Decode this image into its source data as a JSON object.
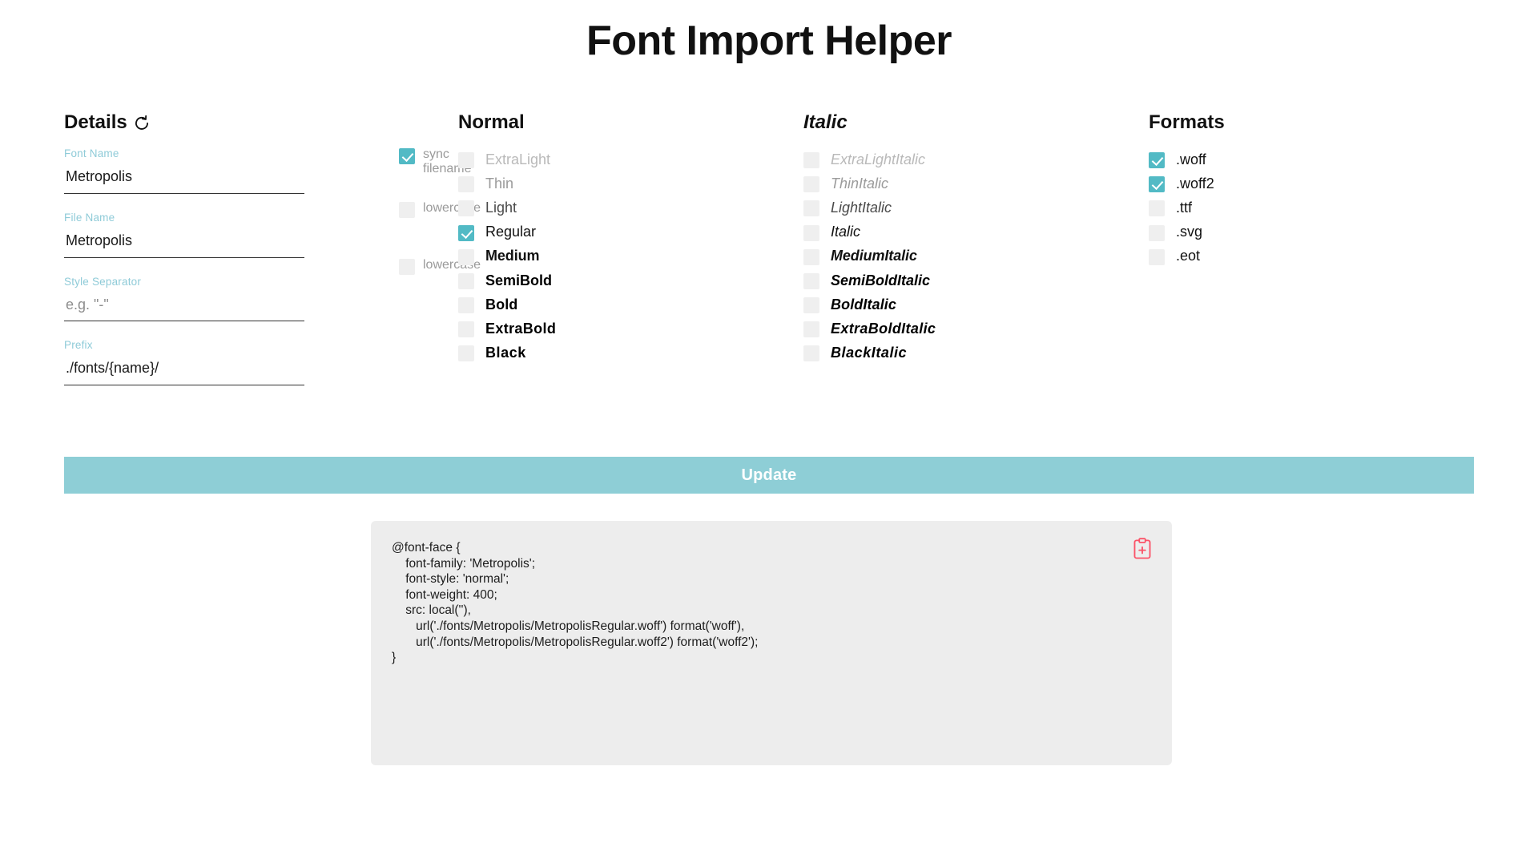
{
  "app": {
    "title": "Font Import Helper"
  },
  "details": {
    "heading": "Details",
    "reset_icon": "refresh-ccw-icon",
    "fields": [
      {
        "label": "Font Name",
        "value": "Metropolis",
        "placeholder": ""
      },
      {
        "label": "File Name",
        "value": "Metropolis",
        "placeholder": ""
      },
      {
        "label": "Style Separator",
        "value": "",
        "placeholder": "e.g. \"-\""
      },
      {
        "label": "Prefix",
        "value": "./fonts/{name}/",
        "placeholder": ""
      }
    ],
    "side_options": [
      {
        "label": "sync filename",
        "checked": true
      },
      {
        "label": "lowercase",
        "checked": false
      },
      {
        "label": "lowercase",
        "checked": false
      }
    ]
  },
  "normal": {
    "heading": "Normal",
    "items": [
      {
        "label": "ExtraLight",
        "checked": false
      },
      {
        "label": "Thin",
        "checked": false
      },
      {
        "label": "Light",
        "checked": false
      },
      {
        "label": "Regular",
        "checked": true
      },
      {
        "label": "Medium",
        "checked": false
      },
      {
        "label": "SemiBold",
        "checked": false
      },
      {
        "label": "Bold",
        "checked": false
      },
      {
        "label": "ExtraBold",
        "checked": false
      },
      {
        "label": "Black",
        "checked": false
      }
    ]
  },
  "italic": {
    "heading": "Italic",
    "items": [
      {
        "label": "ExtraLightItalic",
        "checked": false
      },
      {
        "label": "ThinItalic",
        "checked": false
      },
      {
        "label": "LightItalic",
        "checked": false
      },
      {
        "label": "Italic",
        "checked": false
      },
      {
        "label": "MediumItalic",
        "checked": false
      },
      {
        "label": "SemiBoldItalic",
        "checked": false
      },
      {
        "label": "BoldItalic",
        "checked": false
      },
      {
        "label": "ExtraBoldItalic",
        "checked": false
      },
      {
        "label": "BlackItalic",
        "checked": false
      }
    ]
  },
  "formats": {
    "heading": "Formats",
    "items": [
      {
        "label": ".woff",
        "checked": true
      },
      {
        "label": ".woff2",
        "checked": true
      },
      {
        "label": ".ttf",
        "checked": false
      },
      {
        "label": ".svg",
        "checked": false
      },
      {
        "label": ".eot",
        "checked": false
      }
    ]
  },
  "update": {
    "label": "Update",
    "color": "#8ECED6"
  },
  "output": {
    "copy_icon": "clipboard-plus-icon",
    "copy_icon_color": "#FB5368",
    "code": "@font-face {\n    font-family: 'Metropolis';\n    font-style: 'normal';\n    font-weight: 400;\n    src: local(''),\n       url('./fonts/Metropolis/MetropolisRegular.woff') format('woff'),\n       url('./fonts/Metropolis/MetropolisRegular.woff2') format('woff2');\n}"
  },
  "colors": {
    "accent_teal": "#52BAC5",
    "label_teal": "#8FCBD8",
    "button_teal": "#8ECED6",
    "copy_red": "#FB5368",
    "code_bg": "#ededed"
  }
}
